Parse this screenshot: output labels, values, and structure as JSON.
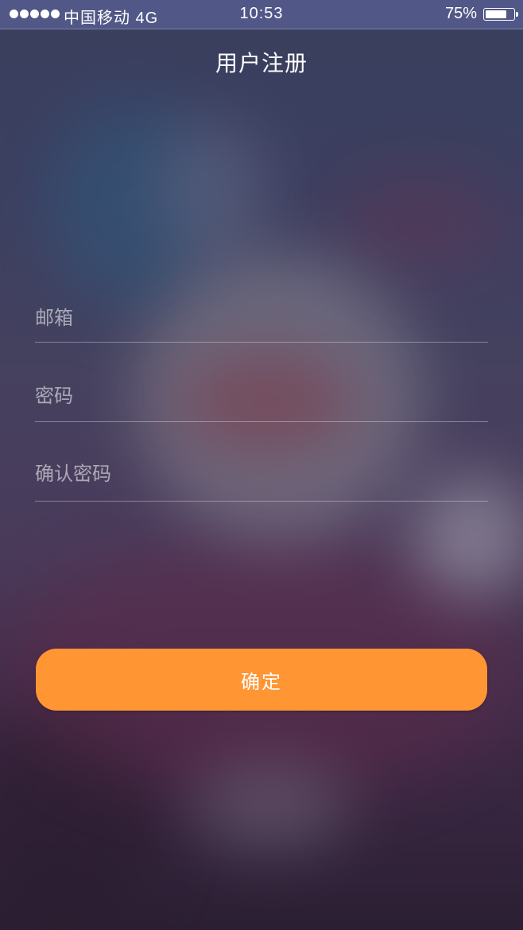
{
  "status_bar": {
    "carrier": "中国移动 4G",
    "time": "10:53",
    "battery_percent": "75%",
    "battery_level": 0.75
  },
  "nav": {
    "title": "用户注册"
  },
  "form": {
    "email_placeholder": "邮箱",
    "password_placeholder": "密码",
    "confirm_password_placeholder": "确认密码",
    "submit_label": "确定"
  },
  "colors": {
    "accent": "#ff9533",
    "text": "#ffffff"
  }
}
